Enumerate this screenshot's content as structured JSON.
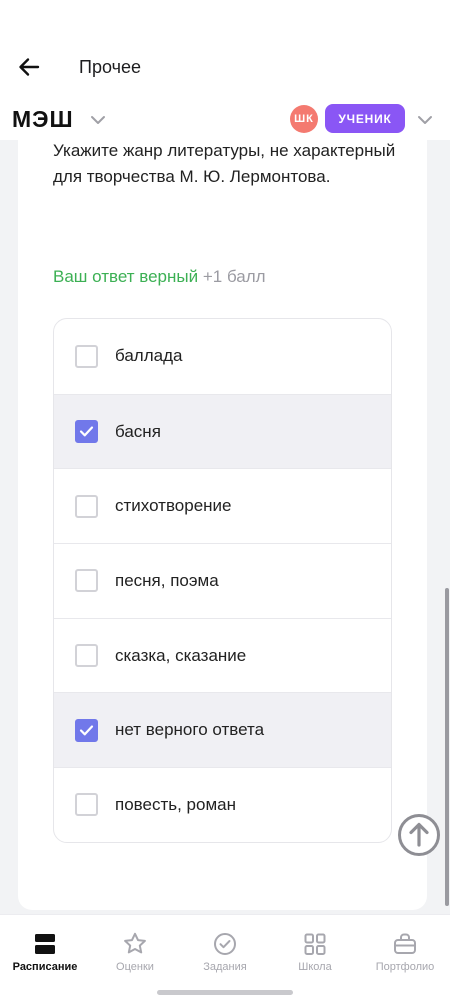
{
  "header": {
    "title": "Прочее",
    "back_icon": "arrow-left-icon"
  },
  "brand": {
    "logo": "МЭШ",
    "avatar_initials": "ШК",
    "avatar_color": "#f47a70",
    "role": "УЧЕНИК",
    "role_color": "#8a56f5"
  },
  "question": {
    "text": "Укажите жанр литературы, не характерный для творчества М. Ю. Лермонтова."
  },
  "result": {
    "status": "Ваш ответ верный",
    "points": "+1 балл",
    "status_color": "#3cb054"
  },
  "options": [
    {
      "label": "баллада",
      "checked": false
    },
    {
      "label": "басня",
      "checked": true
    },
    {
      "label": "стихотворение",
      "checked": false
    },
    {
      "label": "песня, поэма",
      "checked": false
    },
    {
      "label": "сказка, сказание",
      "checked": false
    },
    {
      "label": "нет верного ответа",
      "checked": true
    },
    {
      "label": "повесть, роман",
      "checked": false
    }
  ],
  "accent_color": "#7178ea",
  "tabs": [
    {
      "label": "Расписание",
      "icon": "schedule-icon",
      "active": true
    },
    {
      "label": "Оценки",
      "icon": "star-icon",
      "active": false
    },
    {
      "label": "Задания",
      "icon": "check-circle-icon",
      "active": false
    },
    {
      "label": "Школа",
      "icon": "grid-icon",
      "active": false
    },
    {
      "label": "Портфолио",
      "icon": "briefcase-icon",
      "active": false
    }
  ]
}
